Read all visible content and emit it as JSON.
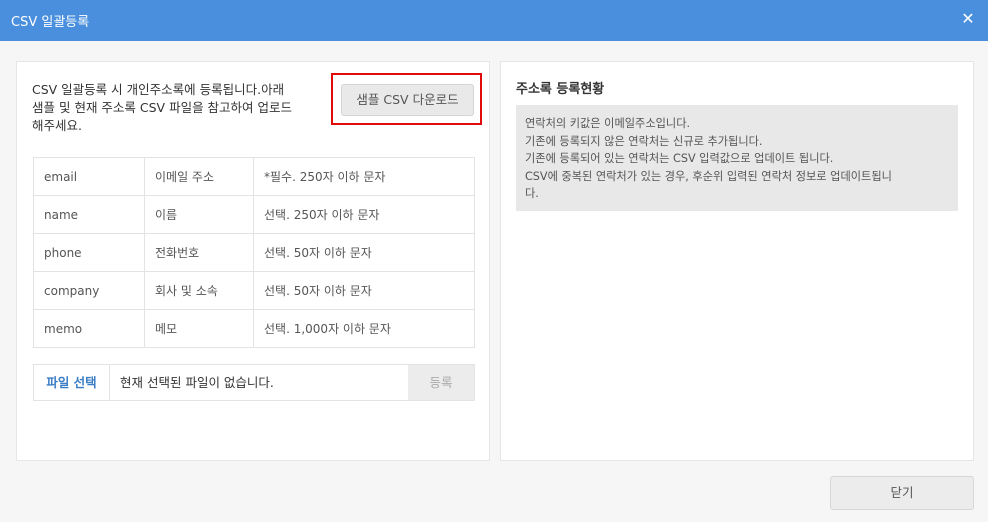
{
  "dialog": {
    "title": "CSV 일괄등록",
    "close_icon": "close-icon"
  },
  "left_panel": {
    "intro_lines": [
      "CSV 일괄등록 시 개인주소록에 등록됩니다.아래",
      "샘플 및 현재 주소록 CSV 파일을 참고하여 업로드",
      "해주세요."
    ],
    "sample_button": "샘플 CSV 다운로드",
    "highlight_color": "#e00b0b",
    "fields": [
      {
        "key": "email",
        "label": "이메일 주소",
        "desc": "*필수. 250자 이하 문자"
      },
      {
        "key": "name",
        "label": "이름",
        "desc": "선택. 250자 이하 문자"
      },
      {
        "key": "phone",
        "label": "전화번호",
        "desc": "선택. 50자 이하 문자"
      },
      {
        "key": "company",
        "label": "회사 및 소속",
        "desc": "선택. 50자 이하 문자"
      },
      {
        "key": "memo",
        "label": "메모",
        "desc": "선택. 1,000자 이하 문자"
      }
    ],
    "file_select": "파일 선택",
    "file_status": "현재 선택된 파일이 없습니다.",
    "register_button": "등록"
  },
  "right_panel": {
    "title": "주소록 등록현황",
    "info_lines": [
      "연락처의 키값은 이메일주소입니다.",
      "기존에 등록되지 않은 연락처는 신규로 추가됩니다.",
      "기존에 등록되어 있는 연락처는 CSV 입력값으로 업데이트 됩니다.",
      "CSV에 중복된 연락처가 있는 경우, 후순위 입력된 연락처 정보로 업데이트됩니",
      "다."
    ]
  },
  "footer": {
    "close_button": "닫기"
  },
  "colors": {
    "titlebar": "#4a8fdd",
    "file_select_text": "#3b7ec6"
  }
}
